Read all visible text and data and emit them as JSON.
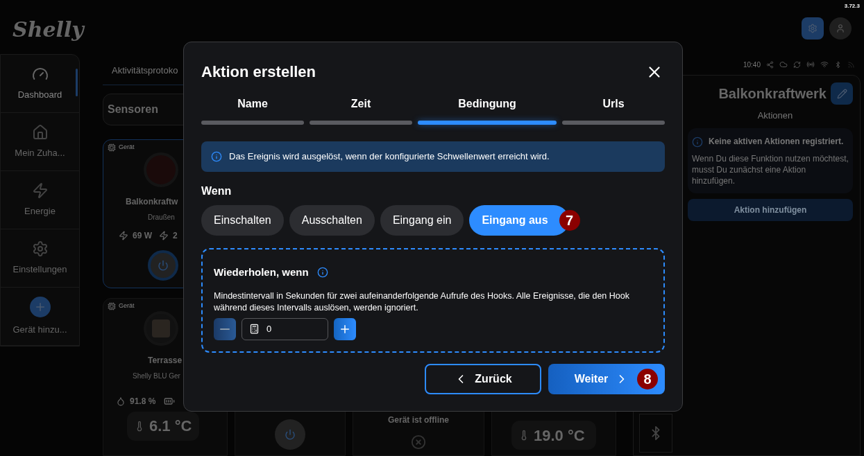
{
  "header": {
    "logo": "Shelly",
    "version": "3.72.3"
  },
  "sidebar": {
    "items": [
      {
        "label": "Dashboard",
        "selected": true
      },
      {
        "label": "Mein Zuha...",
        "selected": false
      },
      {
        "label": "Energie",
        "selected": false
      },
      {
        "label": "Einstellungen",
        "selected": false
      },
      {
        "label": "Gerät hinzu...",
        "selected": false
      }
    ]
  },
  "main": {
    "tab": "Aktivitätsprotoko",
    "section": "Sensoren",
    "devices": [
      {
        "badge": "Gerät",
        "name": "Balkonkraftw",
        "subtitle": "Draußen",
        "readings": [
          "69 W",
          "2"
        ],
        "selected": true
      },
      {
        "badge": "Gerät",
        "name": "Terrasse",
        "subtitle": "Shelly BLU Ger",
        "readings": [
          "91.8 %"
        ],
        "tile": "6.1 °C",
        "selected": false
      }
    ],
    "bottom_tiles": [
      {
        "kind": "power"
      },
      {
        "kind": "offline",
        "text": "Gerät ist offline"
      },
      {
        "kind": "temperature",
        "value": "19.0 °C"
      }
    ]
  },
  "device_panel": {
    "time": "10:40",
    "title": "Balkonkraftwerk",
    "subtitle": "Aktionen",
    "notice_title": "Keine aktiven Aktionen registriert.",
    "notice_text": "Wenn Du diese Funktion nutzen möchtest, musst Du zunächst eine Aktion hinzufügen.",
    "button": "Aktion hinzufügen"
  },
  "dialog": {
    "title": "Aktion erstellen",
    "steps": [
      {
        "label": "Name",
        "selected": false
      },
      {
        "label": "Zeit",
        "selected": false
      },
      {
        "label": "Bedingung",
        "selected": true
      },
      {
        "label": "Urls",
        "selected": false
      }
    ],
    "info": "Das Ereignis wird ausgelöst, wenn der konfigurierte Schwellenwert erreicht wird.",
    "when_label": "Wenn",
    "triggers": [
      {
        "label": "Einschalten",
        "selected": false
      },
      {
        "label": "Ausschalten",
        "selected": false
      },
      {
        "label": "Eingang ein",
        "selected": false
      },
      {
        "label": "Eingang aus",
        "selected": true,
        "marker": "7"
      }
    ],
    "repeat": {
      "title": "Wiederholen, wenn",
      "description": "Mindestintervall in Sekunden für zwei aufeinanderfolgende Aufrufe des Hooks. Alle Ereignisse, die den Hook während dieses Intervalls auslösen, werden ignoriert.",
      "value": "0"
    },
    "back": "Zurück",
    "next": "Weiter",
    "next_marker": "8"
  }
}
